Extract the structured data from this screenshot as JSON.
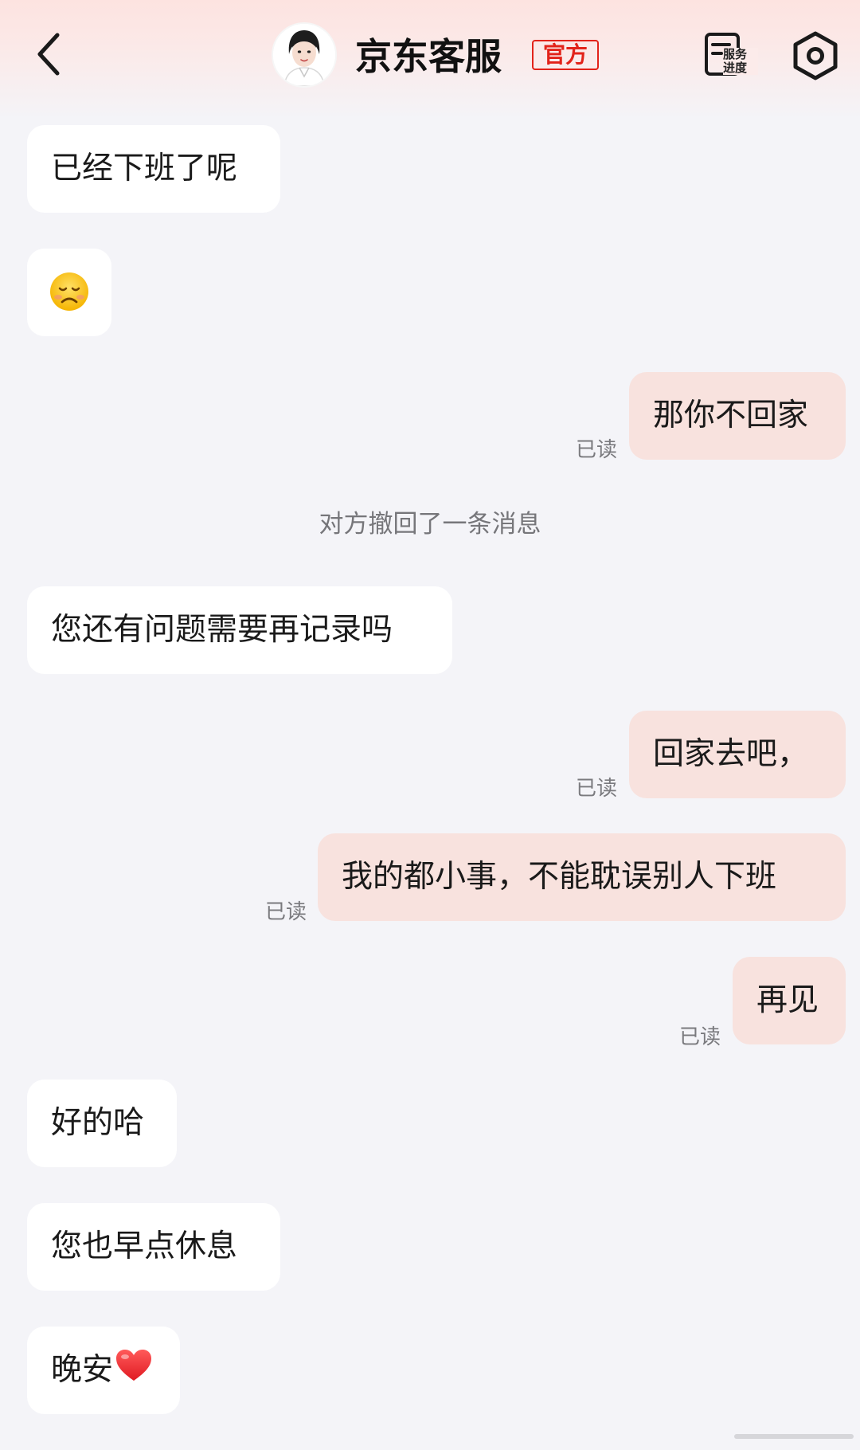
{
  "header": {
    "title": "京东客服",
    "badge": "官方",
    "service_label_line1": "服务",
    "service_label_line2": "进度"
  },
  "colors": {
    "accent_red": "#e2231a",
    "incoming_bubble": "#ffffff",
    "outgoing_bubble": "#f8e2de",
    "background": "#f4f4f8"
  },
  "messages": [
    {
      "direction": "in",
      "text": "已经下班了呢"
    },
    {
      "direction": "in",
      "emoji": "sad-face-icon"
    },
    {
      "direction": "out",
      "text": "那你不回家",
      "status": "已读"
    },
    {
      "system": "对方撤回了一条消息"
    },
    {
      "direction": "in",
      "text": "您还有问题需要再记录吗"
    },
    {
      "direction": "out",
      "text": "回家去吧，",
      "status": "已读"
    },
    {
      "direction": "out",
      "text": "我的都小事，不能耽误别人下班",
      "status": "已读"
    },
    {
      "direction": "out",
      "text": "再见",
      "status": "已读"
    },
    {
      "direction": "in",
      "text": "好的哈"
    },
    {
      "direction": "in",
      "text": "您也早点休息"
    },
    {
      "direction": "in",
      "text": "晚安",
      "emoji": "red-heart-icon"
    }
  ]
}
